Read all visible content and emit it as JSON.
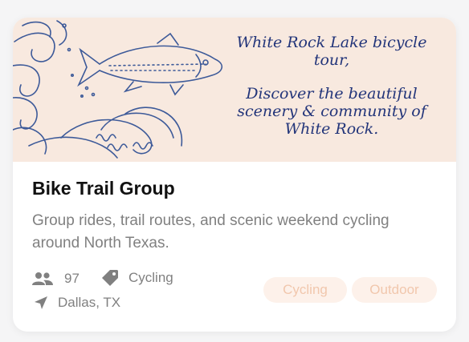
{
  "group": {
    "name": "Bike Trail Group",
    "description": "Group rides, trail routes, and scenic weekend cycling around North Texas.",
    "banner": {
      "line1": "White Rock Lake bicycle",
      "line2": "tour,",
      "line3": "Discover the beautiful",
      "line4": "scenery & community of",
      "line5": "White Rock."
    },
    "member_count": "97",
    "category": "Cycling",
    "location": "Dallas, TX",
    "tags": [
      "Cycling",
      "Outdoor"
    ]
  },
  "icons": {
    "members": "people-icon",
    "category": "tag-icon",
    "location": "location-arrow-icon"
  },
  "colors": {
    "banner_bg": "#f8e9df",
    "banner_ink": "#23357a",
    "chip_bg": "#fdf1ea",
    "chip_text": "#f1c7ad"
  }
}
